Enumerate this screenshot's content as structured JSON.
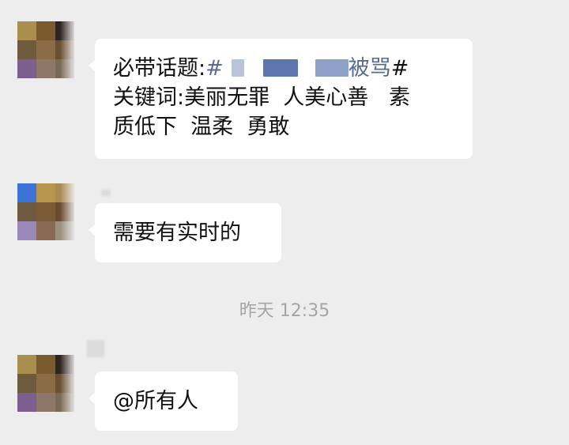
{
  "colors": {
    "background": "#ededed",
    "bubble": "#ffffff",
    "text": "#111111",
    "hashtag_link": "#576b95",
    "timestamp": "#a5a5a5",
    "redaction_mask": "#5c77ad"
  },
  "messages": [
    {
      "avatar": [
        "#a98e4e",
        "#7a5a2f",
        "#2f2320",
        "#6e5a3c",
        "#8a6d47",
        "#6a5030",
        "#7d5f8f",
        "#8c7768",
        "#7a6a55"
      ],
      "line1_prefix": "必带话题:",
      "line1_hash_open": "#",
      "line1_hash_tail": "被骂",
      "line1_hash_close": "#",
      "line2": "关键词:美丽无罪  人美心善   素",
      "line3": "质低下  温柔  勇敢"
    },
    {
      "avatar": [
        "#3d73d6",
        "#b8964e",
        "#a98a50",
        "#6e5a40",
        "#7b5a35",
        "#6b4a2e",
        "#9a88b8",
        "#8a6a55",
        "#9c8f80"
      ],
      "text": "需要有实时的"
    },
    {
      "avatar": [
        "#a98e4e",
        "#7a5a2f",
        "#2f2320",
        "#6e5a3c",
        "#8a6d47",
        "#6a5030",
        "#7d5f8f",
        "#8c7768",
        "#7a6a55"
      ],
      "text": "@所有人"
    }
  ],
  "timestamp": "昨天 12:35"
}
